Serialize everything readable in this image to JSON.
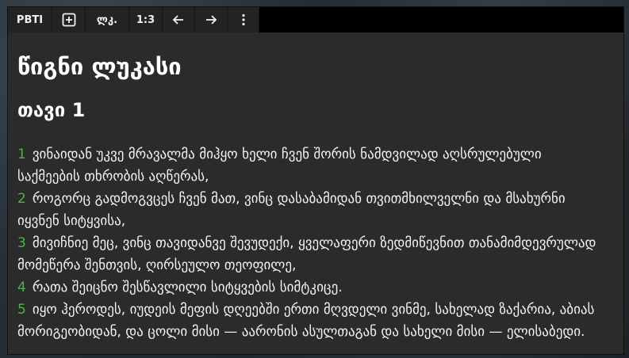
{
  "toolbar": {
    "buttons": [
      {
        "id": "version",
        "label": "PBTI"
      },
      {
        "id": "add",
        "icon": "plus-box-icon"
      },
      {
        "id": "book",
        "label": "ლკ."
      },
      {
        "id": "chapter",
        "label": "1:3"
      },
      {
        "id": "prev",
        "icon": "arrow-left-icon"
      },
      {
        "id": "next",
        "icon": "arrow-right-icon"
      },
      {
        "id": "menu",
        "icon": "more-vertical-icon"
      }
    ]
  },
  "book_title": "წიგნი ლუკასი",
  "chapter_title": "თავი 1",
  "verses": [
    {
      "num": "1",
      "text": "ვინაიდან უკვე მრავალმა მიჰყო ხელი ჩვენ შორის ნამდვილად აღსრულებული საქმეების თხრობის აღწერას,"
    },
    {
      "num": "2",
      "text": "როგორც გადმოგვცეს ჩვენ მათ, ვინც დასაბამიდან თვითმხილველნი და მსახურნი იყვნენ სიტყვისა,"
    },
    {
      "num": "3",
      "text": "მივიჩნიე მეც, ვინც თავიდანვე შევუდექი, ყველაფერი ზედმიწევნით თანამიმდევრულად მომეწერა შენთვის, ღირსეულო თეოფილე,"
    },
    {
      "num": "4",
      "text": "რათა შეიცნო შესწავლილი სიტყვების სიმტკიცე."
    },
    {
      "num": "5",
      "text": "იყო ჰეროდეს, იუდეის მეფის დღეებში ერთი მღვდელი ვინმე, სახელად ზაქარია, აბიას მორიგეობიდან, და ცოლი მისი — აარონის ასულთაგან და სახელი მისი — ელისაბედი."
    }
  ],
  "colors": {
    "verse_number": "#4fb34a",
    "text": "#ffffff",
    "panel": "#2b2b2b",
    "toolbar": "#232323"
  }
}
